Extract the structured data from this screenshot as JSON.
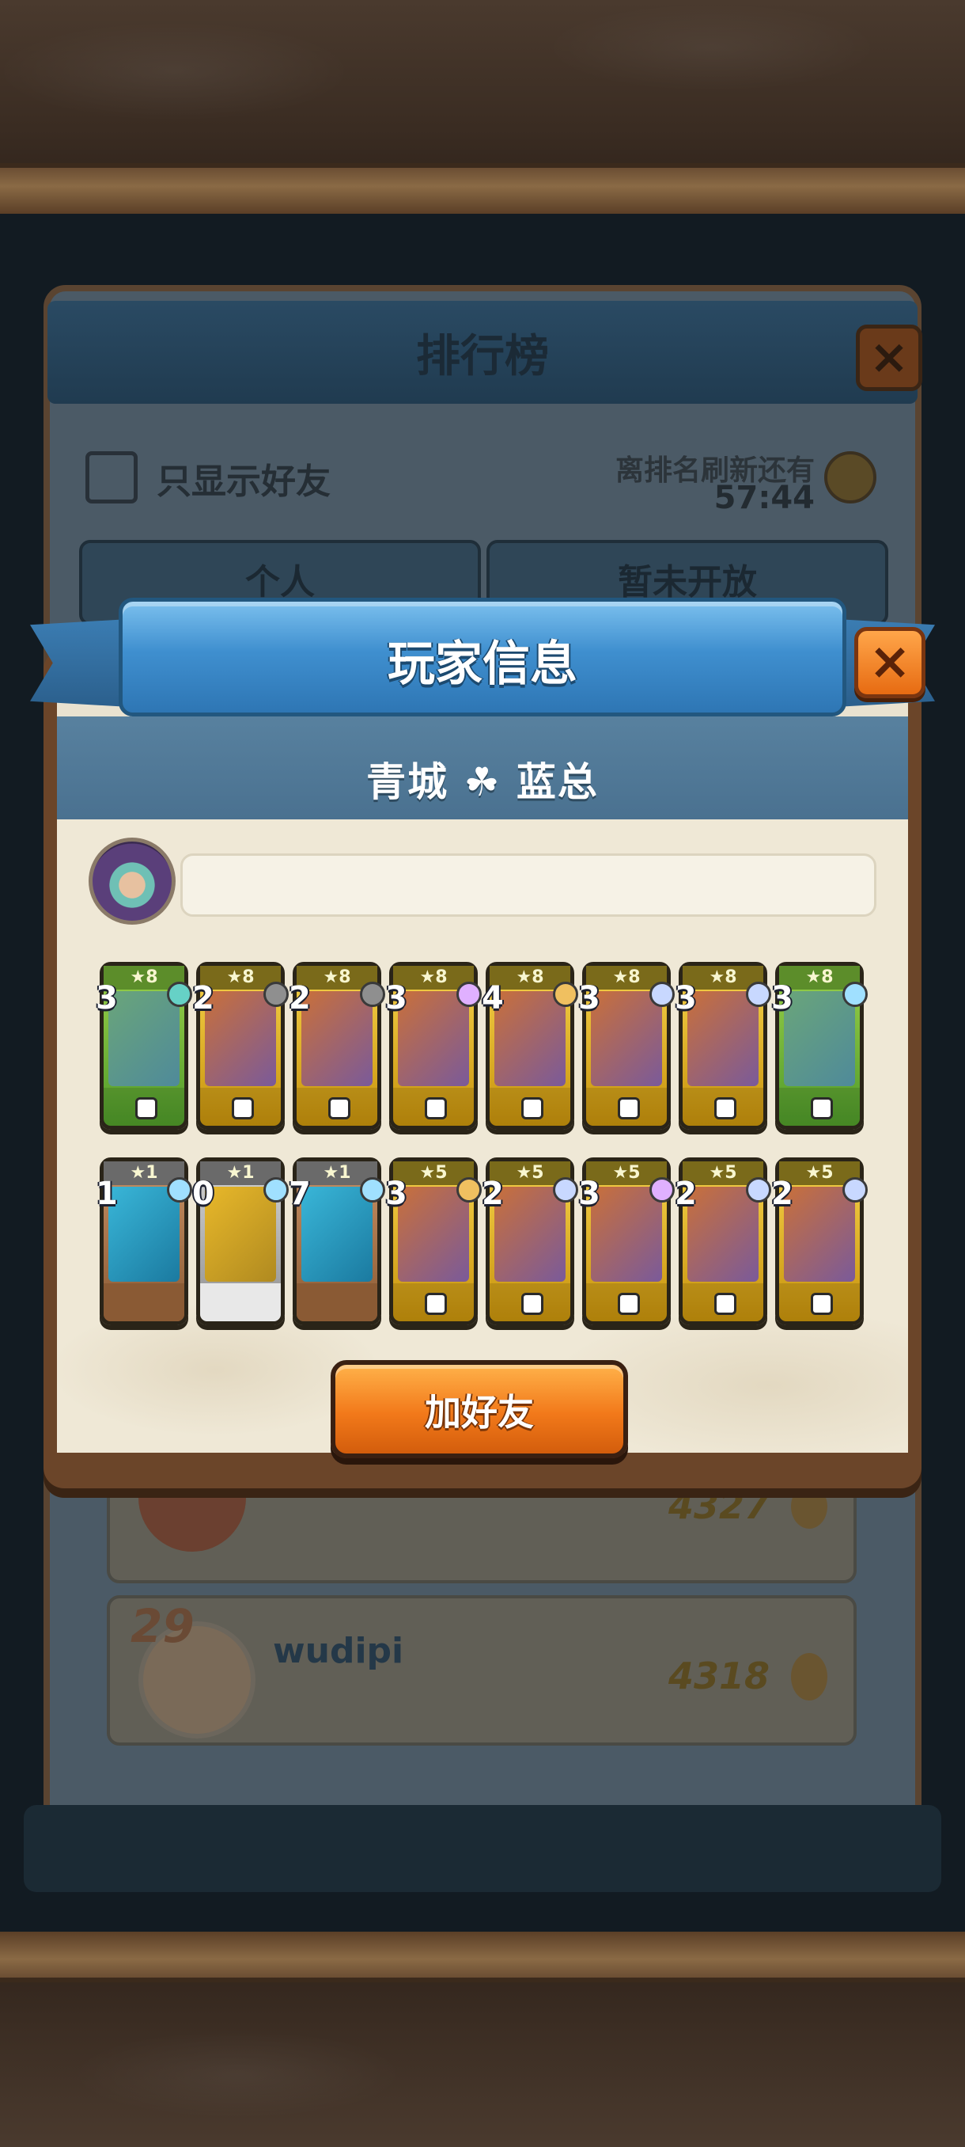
{
  "leaderboard": {
    "title": "排行榜",
    "filter_label": "只显示好友",
    "refresh_label": "离排名刷新还有",
    "refresh_timer": "57:44",
    "tabs": [
      "个人",
      "暂未开放"
    ],
    "rows": [
      {
        "rank": "",
        "name": "",
        "score": "4327"
      },
      {
        "rank": "29",
        "name": "wudipi",
        "score": "4318"
      }
    ]
  },
  "popup": {
    "title": "玩家信息",
    "player_name": "青城",
    "player_name_suffix": "蓝总",
    "player_name_separator_icon": "clover-icon",
    "add_friend_label": "加好友"
  },
  "deck": {
    "row1": [
      {
        "stars": "★8",
        "level": "3",
        "color": "green",
        "gem": "#66d1c6"
      },
      {
        "stars": "★8",
        "level": "2",
        "color": "gold",
        "gem": "#8f8f8f"
      },
      {
        "stars": "★8",
        "level": "2",
        "color": "gold",
        "gem": "#8f8f8f"
      },
      {
        "stars": "★8",
        "level": "3",
        "color": "gold",
        "gem": "#e0b0ff"
      },
      {
        "stars": "★8",
        "level": "4",
        "color": "gold",
        "gem": "#f0c060"
      },
      {
        "stars": "★8",
        "level": "3",
        "color": "gold",
        "gem": "#c8d8ff"
      },
      {
        "stars": "★8",
        "level": "3",
        "color": "gold",
        "gem": "#c8d8ff"
      },
      {
        "stars": "★8",
        "level": "3",
        "color": "green",
        "gem": "#a0e0ff"
      }
    ],
    "row2": [
      {
        "stars": "★1",
        "level": "1",
        "color": "brown",
        "gem": "#a0e0ff"
      },
      {
        "stars": "★1",
        "level": "0",
        "color": "grey",
        "gem": "#a0e0ff"
      },
      {
        "stars": "★1",
        "level": "7",
        "color": "brown",
        "gem": "#a0e0ff"
      },
      {
        "stars": "★5",
        "level": "3",
        "color": "gold",
        "gem": "#f0c060"
      },
      {
        "stars": "★5",
        "level": "2",
        "color": "gold",
        "gem": "#c8d8ff"
      },
      {
        "stars": "★5",
        "level": "3",
        "color": "gold",
        "gem": "#e0b0ff"
      },
      {
        "stars": "★5",
        "level": "2",
        "color": "gold",
        "gem": "#c8d8ff"
      },
      {
        "stars": "★5",
        "level": "2",
        "color": "gold",
        "gem": "#c8d8ff"
      }
    ]
  }
}
